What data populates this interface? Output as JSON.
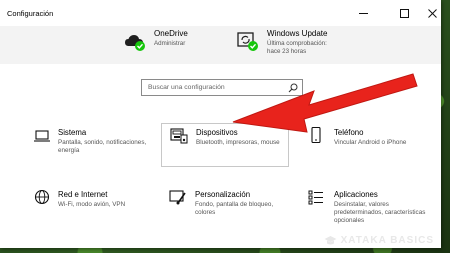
{
  "window": {
    "title": "Configuración"
  },
  "header": {
    "items": [
      {
        "title": "OneDrive",
        "subtitle": "Administrar"
      },
      {
        "title": "Windows Update",
        "subtitle": "Última comprobación:\nhace 23 horas"
      }
    ]
  },
  "search": {
    "placeholder": "Buscar una configuración"
  },
  "tiles": [
    {
      "title": "Sistema",
      "desc": "Pantalla, sonido, notificaciones, energía",
      "icon": "laptop-icon"
    },
    {
      "title": "Dispositivos",
      "desc": "Bluetooth, impresoras, mouse",
      "icon": "printer-keyboard-icon"
    },
    {
      "title": "Teléfono",
      "desc": "Vincular Android o iPhone",
      "icon": "phone-icon"
    },
    {
      "title": "Red e Internet",
      "desc": "Wi-Fi, modo avión, VPN",
      "icon": "globe-icon"
    },
    {
      "title": "Personalización",
      "desc": "Fondo, pantalla de bloqueo, colores",
      "icon": "brush-icon"
    },
    {
      "title": "Aplicaciones",
      "desc": "Desinstalar, valores predeterminados, características opcionales",
      "icon": "apps-list-icon"
    }
  ],
  "watermark": {
    "text": "XATAKA BASICS"
  },
  "colors": {
    "accent": "#0078d7",
    "check_green": "#16c60c",
    "arrow_red": "#e8231c"
  }
}
